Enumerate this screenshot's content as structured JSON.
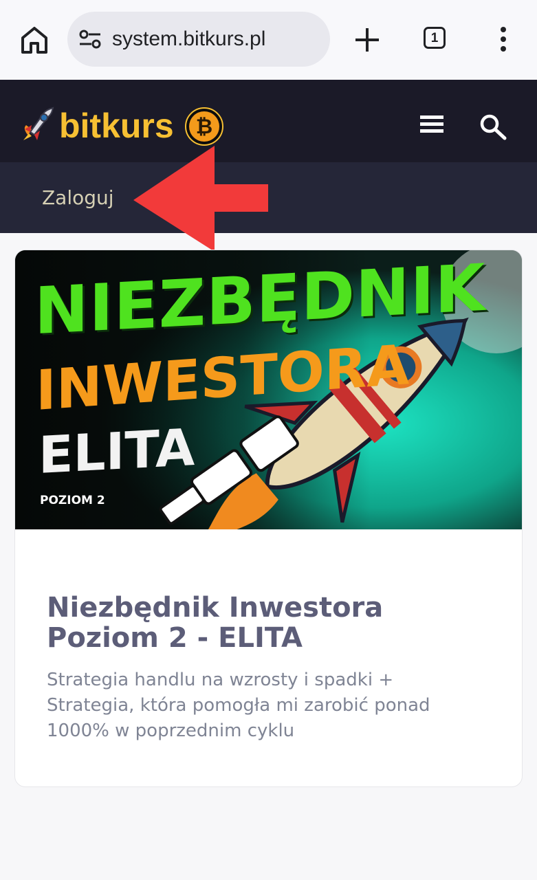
{
  "browser": {
    "url": "system.bitkurs.pl",
    "tab_count": "1",
    "icons": [
      "home-icon",
      "site-settings-icon",
      "new-tab-icon",
      "tabs-icon",
      "more-menu-icon"
    ]
  },
  "site": {
    "logo_text": "bitkurs",
    "brand_color": "#f7c033",
    "header_bg": "#1b1a28",
    "icons": [
      "rocket-icon",
      "bitcoin-icon",
      "hamburger-menu-icon",
      "search-icon"
    ]
  },
  "subnav": {
    "login_label": "Zaloguj"
  },
  "annotation": {
    "arrow_color": "#f23a3a"
  },
  "card": {
    "banner": {
      "line1": "NIEZBĘDNIK",
      "line2": "INWESTORA",
      "line3": "ELITA",
      "level": "POZIOM 2"
    },
    "title": "Niezbędnik Inwestora Poziom 2 - ELITA",
    "description": "Strategia handlu na wzrosty i spadki + Strategia, która pomogła mi zarobić ponad 1000% w poprzednim cyklu"
  }
}
